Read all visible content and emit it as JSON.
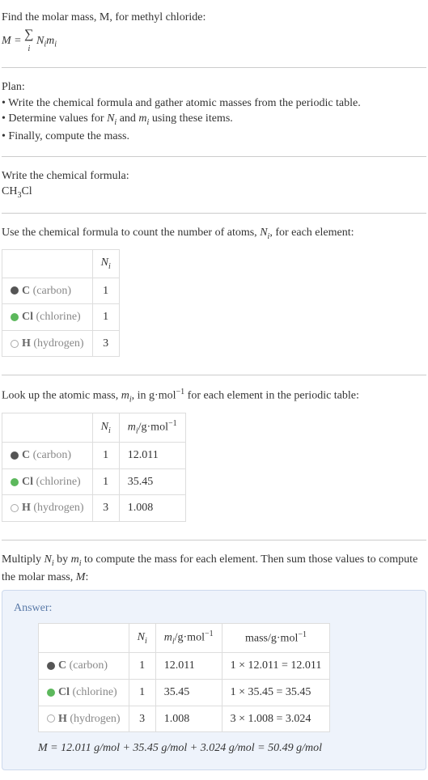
{
  "intro": {
    "line1": "Find the molar mass, M, for methyl chloride:",
    "formula_lhs": "M",
    "formula_eq": " = ",
    "formula_sigma": "∑",
    "formula_sub": "i",
    "formula_rhs_a": " N",
    "formula_rhs_b": "m"
  },
  "plan": {
    "title": "Plan:",
    "b1": "• Write the chemical formula and gather atomic masses from the periodic table.",
    "b2_a": "• Determine values for ",
    "b2_n": "N",
    "b2_and": " and ",
    "b2_m": "m",
    "b2_end": " using these items.",
    "b3": "• Finally, compute the mass."
  },
  "step1": {
    "title": "Write the chemical formula:",
    "formula_a": "CH",
    "formula_sub": "3",
    "formula_b": "Cl"
  },
  "step2": {
    "title_a": "Use the chemical formula to count the number of atoms, ",
    "title_n": "N",
    "title_b": ", for each element:",
    "header_n": "N",
    "rows": [
      {
        "dotClass": "dot-c",
        "sym": "C",
        "name": " (carbon)",
        "n": "1"
      },
      {
        "dotClass": "dot-cl",
        "sym": "Cl",
        "name": " (chlorine)",
        "n": "1"
      },
      {
        "dotClass": "dot-h",
        "sym": "H",
        "name": " (hydrogen)",
        "n": "3"
      }
    ]
  },
  "step3": {
    "title_a": "Look up the atomic mass, ",
    "title_m": "m",
    "title_b": ", in g·mol",
    "title_exp": "−1",
    "title_c": " for each element in the periodic table:",
    "header_n": "N",
    "header_m_a": "m",
    "header_m_b": "/g·mol",
    "header_m_exp": "−1",
    "rows": [
      {
        "dotClass": "dot-c",
        "sym": "C",
        "name": " (carbon)",
        "n": "1",
        "m": "12.011"
      },
      {
        "dotClass": "dot-cl",
        "sym": "Cl",
        "name": " (chlorine)",
        "n": "1",
        "m": "35.45"
      },
      {
        "dotClass": "dot-h",
        "sym": "H",
        "name": " (hydrogen)",
        "n": "3",
        "m": "1.008"
      }
    ]
  },
  "step4": {
    "title_a": "Multiply ",
    "title_n": "N",
    "title_b": " by ",
    "title_m": "m",
    "title_c": " to compute the mass for each element. Then sum those values to compute the molar mass, ",
    "title_M": "M",
    "title_d": ":"
  },
  "answer": {
    "label": "Answer:",
    "header_n": "N",
    "header_m_a": "m",
    "header_m_b": "/g·mol",
    "header_m_exp": "−1",
    "header_mass_a": "mass/g·mol",
    "header_mass_exp": "−1",
    "rows": [
      {
        "dotClass": "dot-c",
        "sym": "C",
        "name": " (carbon)",
        "n": "1",
        "m": "12.011",
        "calc": "1 × 12.011 = 12.011"
      },
      {
        "dotClass": "dot-cl",
        "sym": "Cl",
        "name": " (chlorine)",
        "n": "1",
        "m": "35.45",
        "calc": "1 × 35.45 = 35.45"
      },
      {
        "dotClass": "dot-h",
        "sym": "H",
        "name": " (hydrogen)",
        "n": "3",
        "m": "1.008",
        "calc": "3 × 1.008 = 3.024"
      }
    ],
    "final": "M = 12.011 g/mol + 35.45 g/mol + 3.024 g/mol = 50.49 g/mol"
  }
}
